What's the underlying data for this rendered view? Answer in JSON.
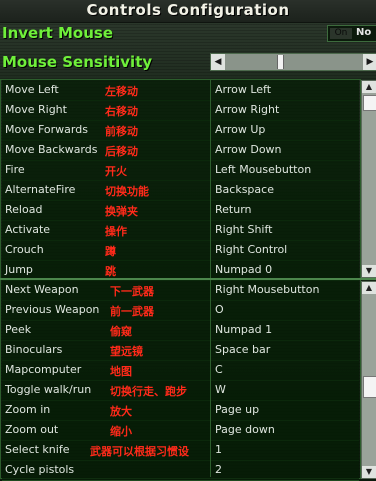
{
  "title": "Controls Configuration",
  "invert_mouse": {
    "label": "Invert Mouse",
    "toggle_on": "On",
    "toggle_off": "No"
  },
  "mouse_sensitivity": {
    "label": "Mouse Sensitivity",
    "level": 0.4
  },
  "bindings_top": [
    {
      "action": "Move Left",
      "cn": "左移动",
      "key": "Arrow Left"
    },
    {
      "action": "Move Right",
      "cn": "右移动",
      "key": "Arrow Right"
    },
    {
      "action": "Move Forwards",
      "cn": "前移动",
      "key": "Arrow Up"
    },
    {
      "action": "Move Backwards",
      "cn": "后移动",
      "key": "Arrow Down"
    },
    {
      "action": "Fire",
      "cn": "开火",
      "key": "Left Mousebutton"
    },
    {
      "action": "AlternateFire",
      "cn": "切换功能",
      "key": "Backspace"
    },
    {
      "action": "Reload",
      "cn": "换弹夹",
      "key": "Return"
    },
    {
      "action": "Activate",
      "cn": "操作",
      "key": "Right Shift"
    },
    {
      "action": "Crouch",
      "cn": "蹲",
      "key": "Right Control"
    },
    {
      "action": "Jump",
      "cn": "跳",
      "key": "Numpad 0"
    }
  ],
  "bindings_bottom": [
    {
      "action": "Next Weapon",
      "cn": "下一武器",
      "key": "Right Mousebutton"
    },
    {
      "action": "Previous Weapon",
      "cn": "前一武器",
      "key": "O"
    },
    {
      "action": "Peek",
      "cn": "偷窥",
      "key": "Numpad 1"
    },
    {
      "action": "Binoculars",
      "cn": "望远镜",
      "key": "Space bar"
    },
    {
      "action": "Mapcomputer",
      "cn": "地图",
      "key": "C"
    },
    {
      "action": "Toggle walk/run",
      "cn": "切换行走、跑步",
      "key": "W"
    },
    {
      "action": "Zoom in",
      "cn": "放大",
      "key": "Page up"
    },
    {
      "action": "Zoom out",
      "cn": "缩小",
      "key": "Page down"
    },
    {
      "action": "Select knife",
      "cn": "武器可以根据习惯设",
      "key": "1"
    },
    {
      "action": "Cycle pistols",
      "cn": "",
      "key": "2"
    }
  ],
  "colors": {
    "accent": "#6ff03a",
    "annotation": "#ff2a1a"
  }
}
